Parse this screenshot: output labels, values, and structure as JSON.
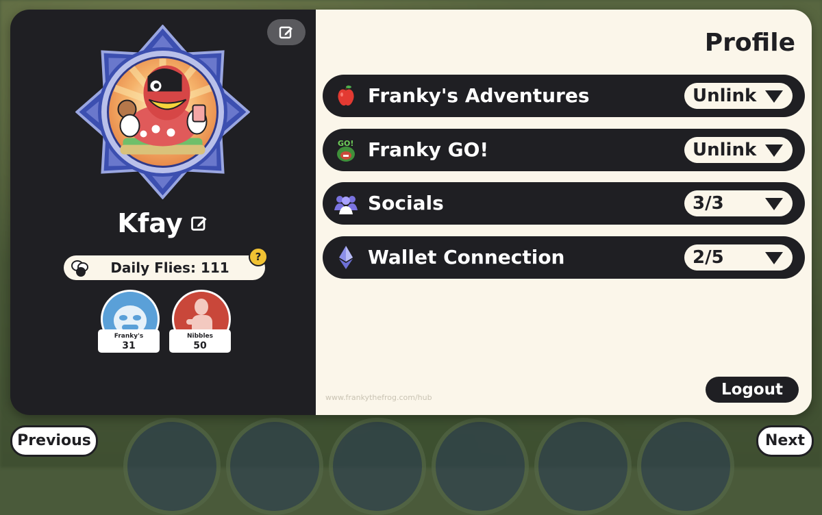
{
  "profile": {
    "username": "Kfay",
    "daily_flies_label": "Daily Flies: 111",
    "help_symbol": "?",
    "tokens": [
      {
        "name": "Franky's",
        "count": "31",
        "color": "#5aa0d8"
      },
      {
        "name": "Nibbles",
        "count": "50",
        "color": "#c9473a"
      }
    ]
  },
  "main": {
    "title": "Profile",
    "rows": [
      {
        "label": "Franky's Adventures",
        "action": "Unlink",
        "icon": "apple-icon"
      },
      {
        "label": "Franky GO!",
        "action": "Unlink",
        "icon": "franky-go-icon"
      },
      {
        "label": "Socials",
        "action": "3/3",
        "icon": "people-icon"
      },
      {
        "label": "Wallet Connection",
        "action": "2/5",
        "icon": "ethereum-icon"
      }
    ],
    "footer_url": "www.frankythefrog.com/hub",
    "logout_label": "Logout"
  },
  "nav": {
    "previous_label": "Previous",
    "next_label": "Next"
  },
  "colors": {
    "dark": "#1f1f23",
    "cream": "#fbf6ea",
    "accent_yellow": "#f1c233"
  }
}
